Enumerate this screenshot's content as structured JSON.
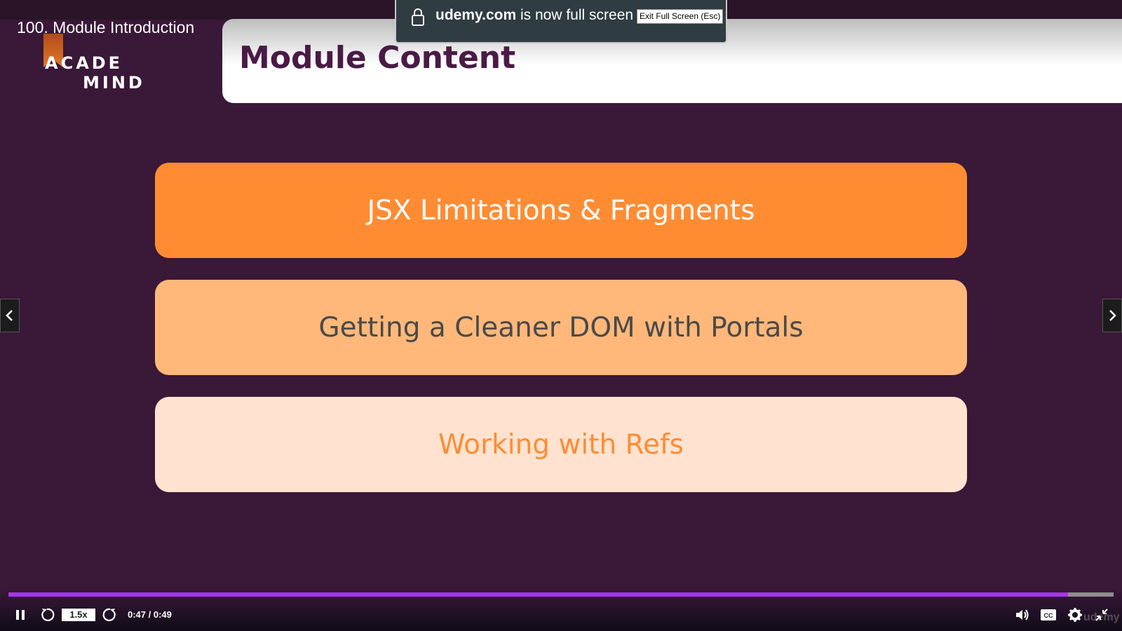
{
  "lecture": {
    "title": "100. Module Introduction"
  },
  "logo": {
    "line1": "ACADE",
    "line2": "MIND"
  },
  "fullscreen_notice": {
    "domain": "udemy.com",
    "message": " is now full screen",
    "exit_label": "Exit Full Screen (Esc)"
  },
  "slide": {
    "heading": "Module Content",
    "items": [
      {
        "label": "JSX Limitations & Fragments"
      },
      {
        "label": "Getting a Cleaner DOM with Portals"
      },
      {
        "label": "Working with Refs"
      }
    ]
  },
  "player": {
    "playback_speed": "1.5x",
    "time": "0:47 / 0:49",
    "progress_fraction": 0.959,
    "watermark": "udemy"
  },
  "colors": {
    "background": "#3a1838",
    "accent_orange": "#ff8c33",
    "progress_purple": "#a435f0",
    "heading_purple": "#4a1a46"
  }
}
